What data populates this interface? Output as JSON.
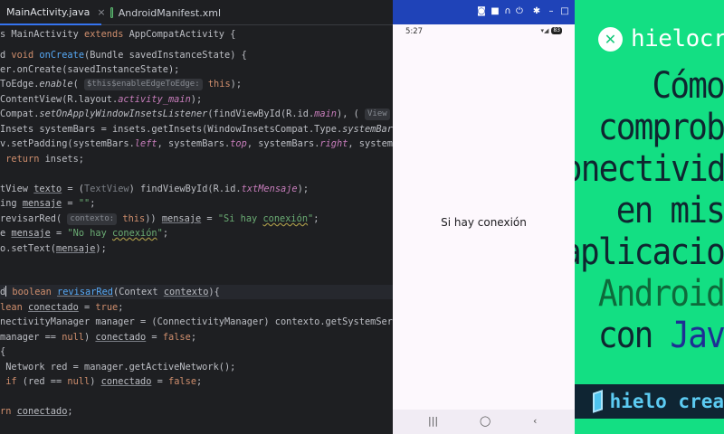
{
  "ide": {
    "tabs": [
      {
        "label": "MainActivity.java",
        "close": "×"
      },
      {
        "label": "AndroidManifest.xml"
      }
    ]
  },
  "emulator": {
    "status": {
      "time": "5:27",
      "signal": "▾◢",
      "battery": "83"
    },
    "message": "Si hay conexión",
    "toolbar_icons": [
      "camera-icon",
      "video-icon",
      "headphones-icon",
      "power-icon",
      "settings-icon",
      "minimize-icon",
      "maximize-icon"
    ],
    "nav": [
      "|||",
      "◯",
      "‹"
    ]
  },
  "banner": {
    "brand_icon": "✕",
    "brand_name": "hielocrea",
    "title_lines": [
      "Cómo",
      "comprob",
      "conectivid",
      "en mis",
      "aplicacio",
      "Android",
      "con Java"
    ],
    "title_line_6_prefix": "con ",
    "title_line_6_java": "Jav",
    "footer_text": "hielo crea",
    "colors": {
      "background": "#13df83",
      "dark_text": "#0f2630",
      "android": "#0e6a3b",
      "java": "#1d2f94",
      "footer_bg": "#0f2533",
      "footer_accent": "#5ccbf2"
    }
  }
}
